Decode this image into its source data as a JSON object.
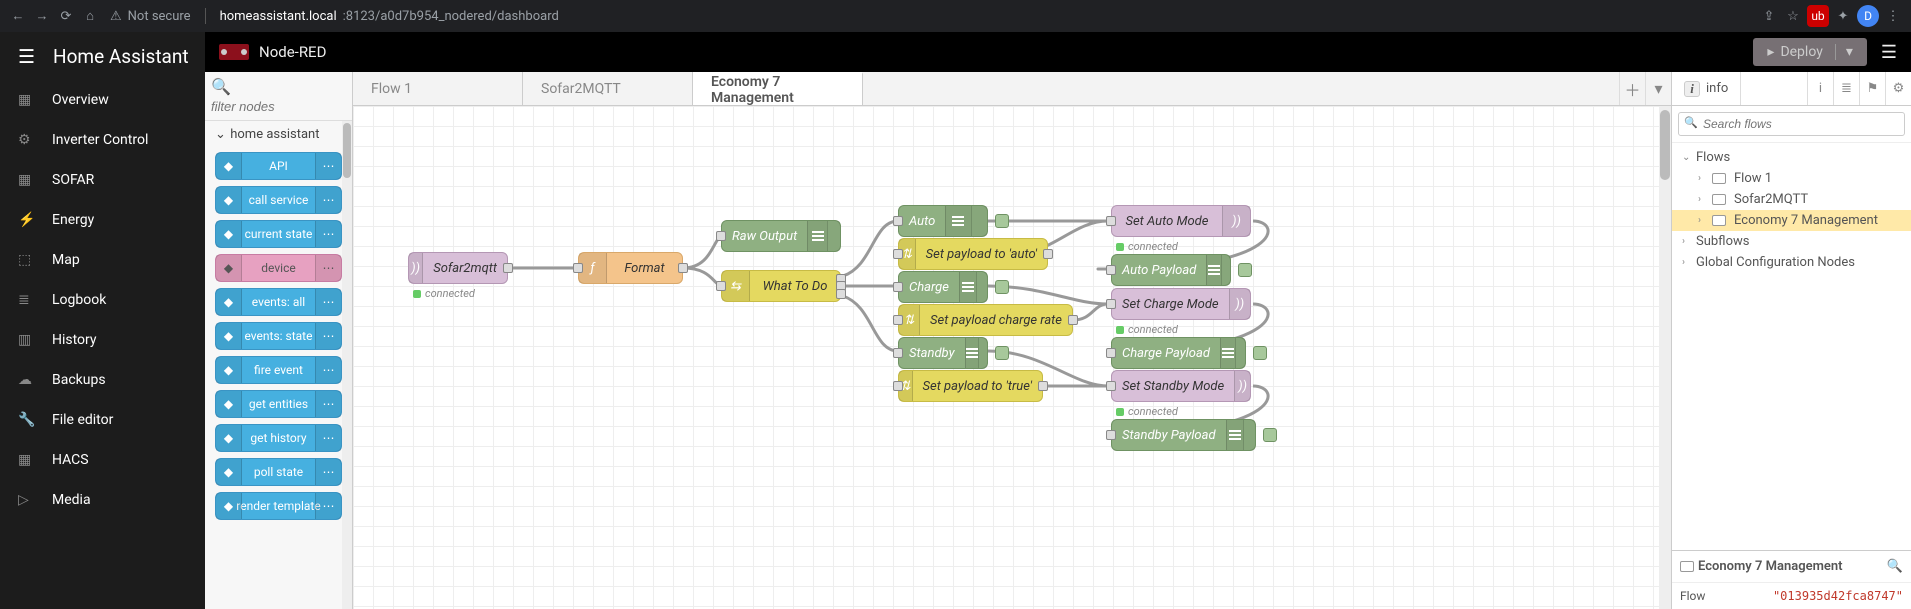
{
  "browser": {
    "security_label": "Not secure",
    "host": "homeassistant.local",
    "port_and_path": ":8123/a0d7b954_nodered/dashboard",
    "profile_initial": "D"
  },
  "ha": {
    "title": "Home Assistant",
    "items": [
      {
        "label": "Overview"
      },
      {
        "label": "Inverter Control"
      },
      {
        "label": "SOFAR"
      },
      {
        "label": "Energy"
      },
      {
        "label": "Map"
      },
      {
        "label": "Logbook"
      },
      {
        "label": "History"
      },
      {
        "label": "Backups"
      },
      {
        "label": "File editor"
      },
      {
        "label": "HACS"
      },
      {
        "label": "Media"
      }
    ]
  },
  "nodered": {
    "title": "Node-RED",
    "deploy": "Deploy",
    "palette_filter_placeholder": "filter nodes",
    "palette_category": "home assistant",
    "palette_nodes": [
      {
        "label": "API"
      },
      {
        "label": "call service"
      },
      {
        "label": "current state"
      },
      {
        "label": "device",
        "pink": true
      },
      {
        "label": "events: all"
      },
      {
        "label": "events: state"
      },
      {
        "label": "fire event"
      },
      {
        "label": "get entities"
      },
      {
        "label": "get history"
      },
      {
        "label": "poll state"
      },
      {
        "label": "render template"
      }
    ],
    "tabs": [
      {
        "label": "Flow 1"
      },
      {
        "label": "Sofar2MQTT"
      },
      {
        "label": "Economy 7 Management",
        "active": true
      }
    ],
    "nodes": {
      "sofar2mqtt": {
        "label": "Sofar2mqtt",
        "status": "connected"
      },
      "format": {
        "label": "Format"
      },
      "rawoutput": {
        "label": "Raw Output"
      },
      "whattodo": {
        "label": "What To Do"
      },
      "auto": {
        "label": "Auto"
      },
      "charge": {
        "label": "Charge"
      },
      "standby": {
        "label": "Standby"
      },
      "pl_auto": {
        "label": "Set payload to 'auto'"
      },
      "pl_rate": {
        "label": "Set payload charge rate"
      },
      "pl_true": {
        "label": "Set payload to 'true'"
      },
      "set_auto": {
        "label": "Set Auto Mode",
        "status": "connected"
      },
      "auto_payload": {
        "label": "Auto Payload"
      },
      "set_charge": {
        "label": "Set Charge Mode",
        "status": "connected"
      },
      "charge_payload": {
        "label": "Charge Payload"
      },
      "set_standby": {
        "label": "Set Standby Mode",
        "status": "connected"
      },
      "standby_payload": {
        "label": "Standby Payload"
      }
    }
  },
  "info": {
    "tab_label": "info",
    "search_placeholder": "Search flows",
    "tree": {
      "flows": "Flows",
      "flow1": "Flow 1",
      "sofar2mqtt": "Sofar2MQTT",
      "eco7": "Economy 7 Management",
      "subflows": "Subflows",
      "global": "Global Configuration Nodes"
    },
    "footer_title": "Economy 7 Management",
    "footer_key": "Flow",
    "footer_val": "\"013935d42fca8747\""
  }
}
